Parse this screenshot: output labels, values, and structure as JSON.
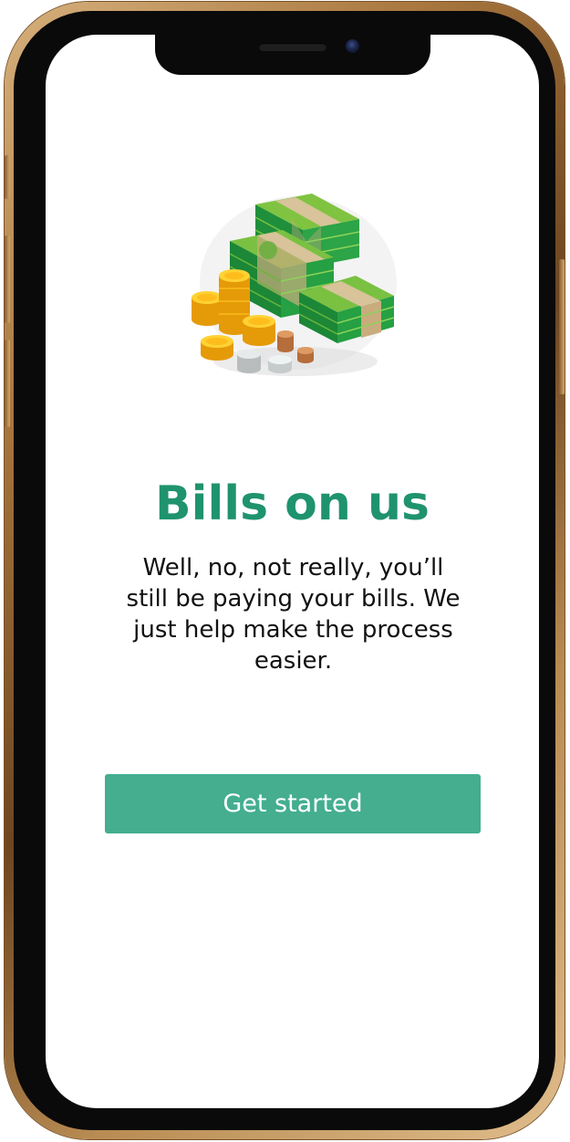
{
  "onboarding": {
    "title": "Bills on us",
    "description": "Well, no, not really, you’ll still be paying your bills. We just help make the process easier.",
    "illustration": "money-stack-icon"
  },
  "actions": {
    "primary_label": "Get started"
  },
  "colors": {
    "accent": "#1f936e",
    "button": "#44ae8f",
    "text": "#111111",
    "background": "#ffffff",
    "frame": "#b88b52"
  }
}
